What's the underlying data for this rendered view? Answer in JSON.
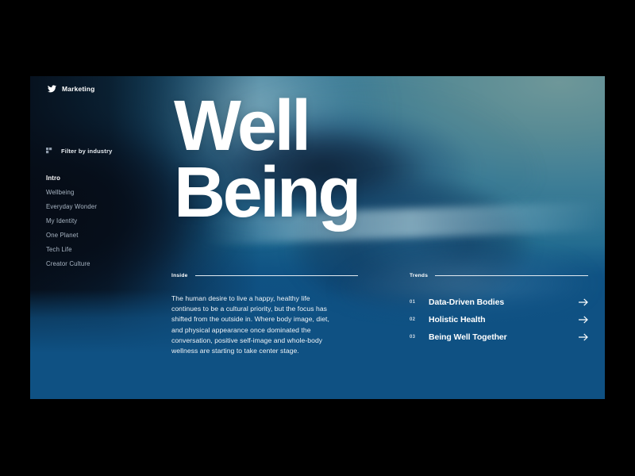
{
  "brand": {
    "icon": "twitter-bird-icon",
    "label": "Marketing"
  },
  "filter": {
    "icon": "filter-icon",
    "label": "Filter by industry"
  },
  "nav": {
    "items": [
      {
        "label": "Intro",
        "active": true
      },
      {
        "label": "Wellbeing",
        "active": false
      },
      {
        "label": "Everyday Wonder",
        "active": false
      },
      {
        "label": "My Identity",
        "active": false
      },
      {
        "label": "One Planet",
        "active": false
      },
      {
        "label": "Tech Life",
        "active": false
      },
      {
        "label": "Creator Culture",
        "active": false
      }
    ]
  },
  "hero": {
    "title_line1": "Well",
    "title_line2": "Being"
  },
  "inside": {
    "section_label": "Inside",
    "body": "The human desire to live a happy, healthy life continues to be a cultural priority, but the focus has shifted from the outside in. Where body image, diet, and physical appearance once dominated the conversation, positive self-image and whole-body wellness are starting to take center stage."
  },
  "trends": {
    "section_label": "Trends",
    "items": [
      {
        "number": "01",
        "label": "Data-Driven Bodies",
        "arrow": "arrow-right-icon"
      },
      {
        "number": "02",
        "label": "Holistic Health",
        "arrow": "arrow-right-icon"
      },
      {
        "number": "03",
        "label": "Being Well Together",
        "arrow": "arrow-right-icon"
      }
    ]
  },
  "colors": {
    "panel_blue": "#0F5183",
    "letterbox": "#000000",
    "text_white": "#FFFFFF",
    "nav_muted": "#A9B6C4",
    "teal_highlight": "#5E8C94"
  }
}
